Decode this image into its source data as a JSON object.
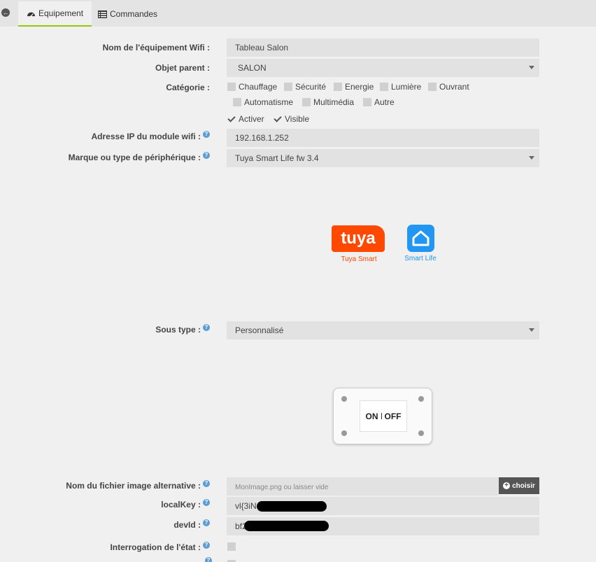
{
  "tabs": {
    "equipement": "Equipement",
    "commandes": "Commandes"
  },
  "form": {
    "nom_label": "Nom de l'équipement Wifi :",
    "nom_value": "Tableau Salon",
    "parent_label": "Objet parent :",
    "parent_value": "SALON",
    "categorie_label": "Catégorie :",
    "categories": [
      "Chauffage",
      "Sécurité",
      "Energie",
      "Lumière",
      "Ouvrant",
      "Automatisme",
      "Multimédia",
      "Autre"
    ],
    "activer": "Activer",
    "visible": "Visible",
    "ip_label": "Adresse IP du module wifi :",
    "ip_value": "192.168.1.252",
    "marque_label": "Marque ou type de périphérique :",
    "marque_value": "Tuya Smart Life fw 3.4",
    "soustype_label": "Sous type :",
    "soustype_value": "Personnalisé",
    "image_label": "Nom du fichier image alternative :",
    "image_placeholder": "MonImage.png ou laisser vide",
    "choisir": "choisir",
    "localkey_label": "localKey :",
    "localkey_value": "vl{3iN",
    "devid_label": "devId :",
    "devid_value": "bf2",
    "interrogation_label": "Interrogation de l'état :"
  },
  "logos": {
    "tuya_word": "tuya",
    "tuya_caption": "Tuya Smart",
    "smartlife_caption": "Smart Life"
  },
  "device": {
    "on": "ON",
    "off": "OFF"
  },
  "colors": {
    "tuya_orange": "#ff4800",
    "smartlife_blue": "#2196f3",
    "help_blue": "#5b9bd5",
    "tab_underline": "#94ca02"
  }
}
